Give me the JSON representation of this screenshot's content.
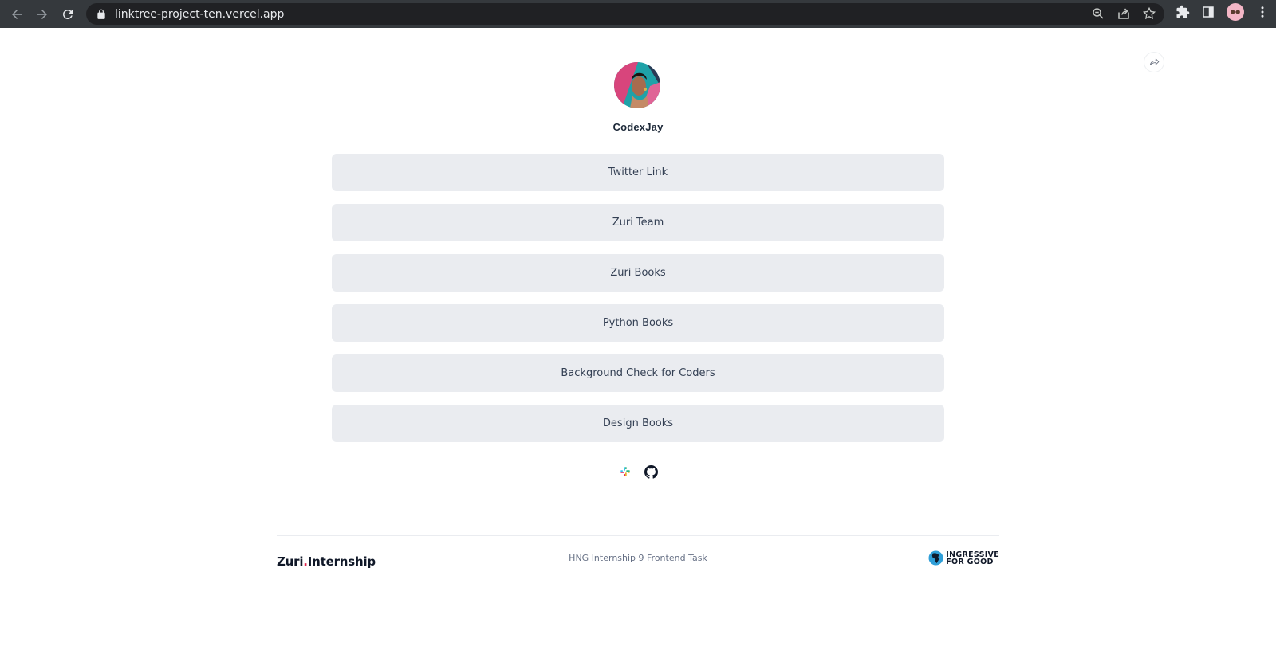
{
  "browser": {
    "url": "linktree-project-ten.vercel.app"
  },
  "profile": {
    "name": "CodexJay"
  },
  "links": [
    {
      "label": "Twitter Link"
    },
    {
      "label": "Zuri Team"
    },
    {
      "label": "Zuri Books"
    },
    {
      "label": "Python Books"
    },
    {
      "label": "Background Check for Coders"
    },
    {
      "label": "Design Books"
    }
  ],
  "socials": [
    {
      "icon": "slack-icon"
    },
    {
      "icon": "github-icon"
    }
  ],
  "footer": {
    "logo_left": "Zuri",
    "logo_dot": ".",
    "logo_right": "Internship",
    "center_text": "HNG Internship 9 Frontend Task",
    "right_logo_line1": "INGRESSIVE",
    "right_logo_line2": "FOR GOOD"
  },
  "colors": {
    "chrome_bg": "#35393d",
    "omnibox_bg": "#202124",
    "link_bg": "#eaecf0",
    "accent_dot": "#e11d48"
  }
}
